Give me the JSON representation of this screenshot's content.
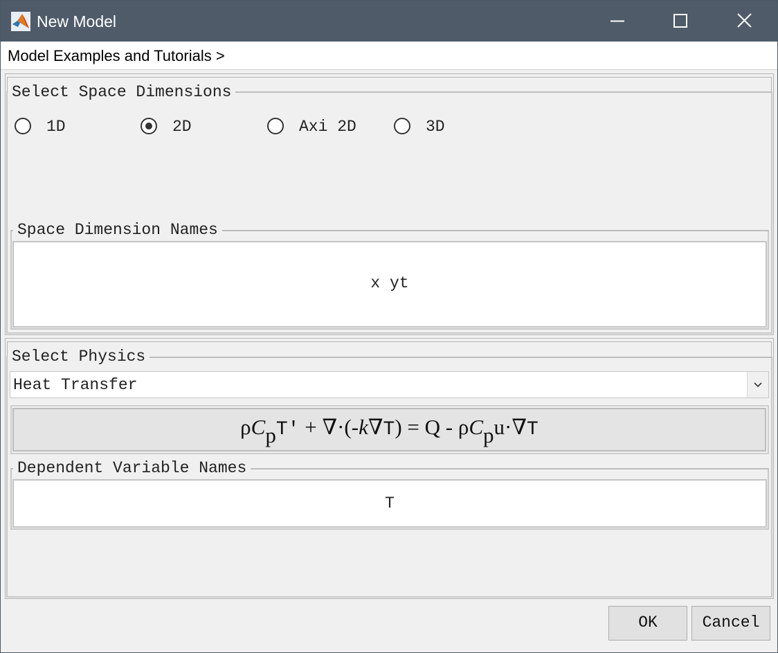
{
  "window": {
    "title": "New Model",
    "app_icon": "matlab-logo-icon",
    "controls": [
      "minimize-icon",
      "maximize-icon",
      "close-icon"
    ]
  },
  "menubar": {
    "item": "Model Examples and Tutorials >"
  },
  "space_dimensions": {
    "legend": "Select Space Dimensions",
    "options": [
      {
        "label": "1D",
        "selected": false
      },
      {
        "label": "2D",
        "selected": true
      },
      {
        "label": "Axi 2D",
        "selected": false
      },
      {
        "label": "3D",
        "selected": false
      }
    ],
    "names_legend": "Space Dimension Names",
    "names_value": "x yt"
  },
  "physics": {
    "legend": "Select Physics",
    "selected": "Heat Transfer",
    "equation": {
      "rho1": "ρ",
      "C1": "C",
      "p1": "p",
      "T1": "T'",
      "plus": " + ",
      "nabla1": "∇",
      "dot1": "·",
      "open": "(-",
      "k": "k",
      "nabla2": "∇",
      "T2": "T",
      "close": ") = Q - ",
      "rho2": "ρ",
      "C2": "C",
      "p2": "p",
      "u": "u",
      "dot2": "·",
      "nabla3": "∇",
      "T3": "T"
    },
    "dep_legend": "Dependent Variable Names",
    "dep_value": "T"
  },
  "buttons": {
    "ok": "OK",
    "cancel": "Cancel"
  },
  "colors": {
    "titlebar": "#4f5b69",
    "background": "#f0f0f0"
  }
}
